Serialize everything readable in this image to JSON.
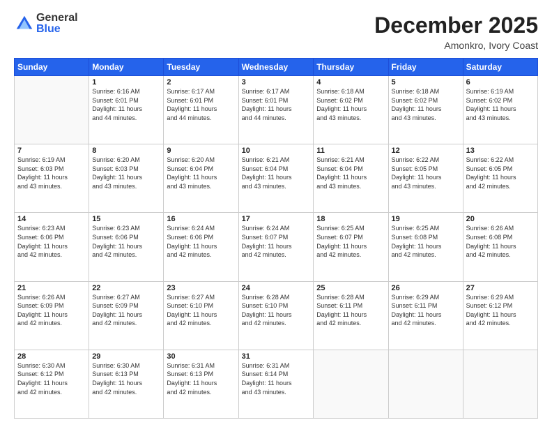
{
  "logo": {
    "general": "General",
    "blue": "Blue"
  },
  "title": "December 2025",
  "subtitle": "Amonkro, Ivory Coast",
  "days_header": [
    "Sunday",
    "Monday",
    "Tuesday",
    "Wednesday",
    "Thursday",
    "Friday",
    "Saturday"
  ],
  "weeks": [
    [
      {
        "day": "",
        "info": ""
      },
      {
        "day": "1",
        "info": "Sunrise: 6:16 AM\nSunset: 6:01 PM\nDaylight: 11 hours\nand 44 minutes."
      },
      {
        "day": "2",
        "info": "Sunrise: 6:17 AM\nSunset: 6:01 PM\nDaylight: 11 hours\nand 44 minutes."
      },
      {
        "day": "3",
        "info": "Sunrise: 6:17 AM\nSunset: 6:01 PM\nDaylight: 11 hours\nand 44 minutes."
      },
      {
        "day": "4",
        "info": "Sunrise: 6:18 AM\nSunset: 6:02 PM\nDaylight: 11 hours\nand 43 minutes."
      },
      {
        "day": "5",
        "info": "Sunrise: 6:18 AM\nSunset: 6:02 PM\nDaylight: 11 hours\nand 43 minutes."
      },
      {
        "day": "6",
        "info": "Sunrise: 6:19 AM\nSunset: 6:02 PM\nDaylight: 11 hours\nand 43 minutes."
      }
    ],
    [
      {
        "day": "7",
        "info": "Sunrise: 6:19 AM\nSunset: 6:03 PM\nDaylight: 11 hours\nand 43 minutes."
      },
      {
        "day": "8",
        "info": "Sunrise: 6:20 AM\nSunset: 6:03 PM\nDaylight: 11 hours\nand 43 minutes."
      },
      {
        "day": "9",
        "info": "Sunrise: 6:20 AM\nSunset: 6:04 PM\nDaylight: 11 hours\nand 43 minutes."
      },
      {
        "day": "10",
        "info": "Sunrise: 6:21 AM\nSunset: 6:04 PM\nDaylight: 11 hours\nand 43 minutes."
      },
      {
        "day": "11",
        "info": "Sunrise: 6:21 AM\nSunset: 6:04 PM\nDaylight: 11 hours\nand 43 minutes."
      },
      {
        "day": "12",
        "info": "Sunrise: 6:22 AM\nSunset: 6:05 PM\nDaylight: 11 hours\nand 43 minutes."
      },
      {
        "day": "13",
        "info": "Sunrise: 6:22 AM\nSunset: 6:05 PM\nDaylight: 11 hours\nand 42 minutes."
      }
    ],
    [
      {
        "day": "14",
        "info": "Sunrise: 6:23 AM\nSunset: 6:06 PM\nDaylight: 11 hours\nand 42 minutes."
      },
      {
        "day": "15",
        "info": "Sunrise: 6:23 AM\nSunset: 6:06 PM\nDaylight: 11 hours\nand 42 minutes."
      },
      {
        "day": "16",
        "info": "Sunrise: 6:24 AM\nSunset: 6:06 PM\nDaylight: 11 hours\nand 42 minutes."
      },
      {
        "day": "17",
        "info": "Sunrise: 6:24 AM\nSunset: 6:07 PM\nDaylight: 11 hours\nand 42 minutes."
      },
      {
        "day": "18",
        "info": "Sunrise: 6:25 AM\nSunset: 6:07 PM\nDaylight: 11 hours\nand 42 minutes."
      },
      {
        "day": "19",
        "info": "Sunrise: 6:25 AM\nSunset: 6:08 PM\nDaylight: 11 hours\nand 42 minutes."
      },
      {
        "day": "20",
        "info": "Sunrise: 6:26 AM\nSunset: 6:08 PM\nDaylight: 11 hours\nand 42 minutes."
      }
    ],
    [
      {
        "day": "21",
        "info": "Sunrise: 6:26 AM\nSunset: 6:09 PM\nDaylight: 11 hours\nand 42 minutes."
      },
      {
        "day": "22",
        "info": "Sunrise: 6:27 AM\nSunset: 6:09 PM\nDaylight: 11 hours\nand 42 minutes."
      },
      {
        "day": "23",
        "info": "Sunrise: 6:27 AM\nSunset: 6:10 PM\nDaylight: 11 hours\nand 42 minutes."
      },
      {
        "day": "24",
        "info": "Sunrise: 6:28 AM\nSunset: 6:10 PM\nDaylight: 11 hours\nand 42 minutes."
      },
      {
        "day": "25",
        "info": "Sunrise: 6:28 AM\nSunset: 6:11 PM\nDaylight: 11 hours\nand 42 minutes."
      },
      {
        "day": "26",
        "info": "Sunrise: 6:29 AM\nSunset: 6:11 PM\nDaylight: 11 hours\nand 42 minutes."
      },
      {
        "day": "27",
        "info": "Sunrise: 6:29 AM\nSunset: 6:12 PM\nDaylight: 11 hours\nand 42 minutes."
      }
    ],
    [
      {
        "day": "28",
        "info": "Sunrise: 6:30 AM\nSunset: 6:12 PM\nDaylight: 11 hours\nand 42 minutes."
      },
      {
        "day": "29",
        "info": "Sunrise: 6:30 AM\nSunset: 6:13 PM\nDaylight: 11 hours\nand 42 minutes."
      },
      {
        "day": "30",
        "info": "Sunrise: 6:31 AM\nSunset: 6:13 PM\nDaylight: 11 hours\nand 42 minutes."
      },
      {
        "day": "31",
        "info": "Sunrise: 6:31 AM\nSunset: 6:14 PM\nDaylight: 11 hours\nand 43 minutes."
      },
      {
        "day": "",
        "info": ""
      },
      {
        "day": "",
        "info": ""
      },
      {
        "day": "",
        "info": ""
      }
    ]
  ]
}
